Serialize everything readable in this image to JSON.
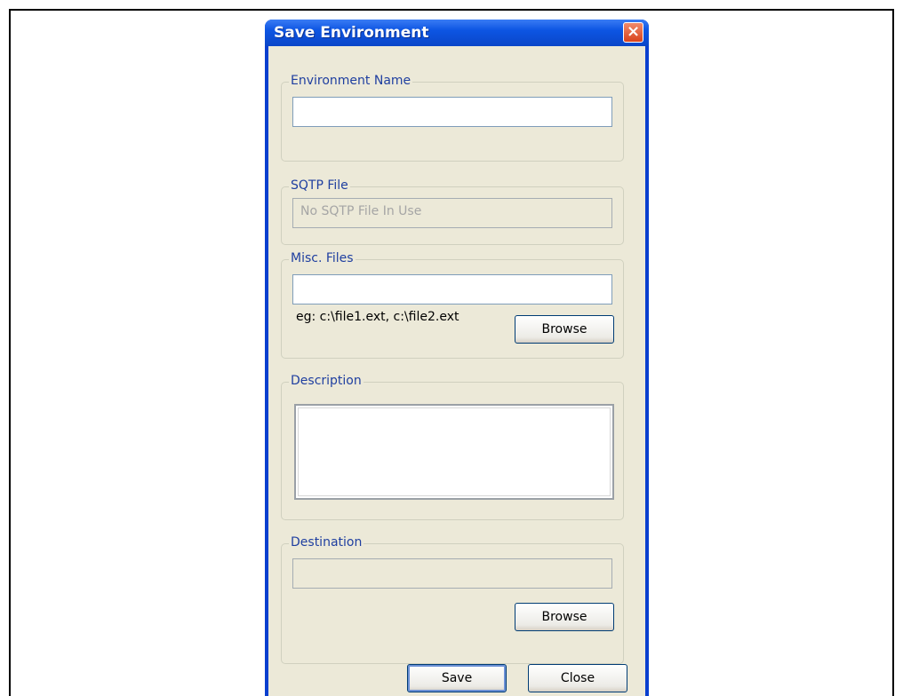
{
  "window": {
    "title": "Save Environment"
  },
  "groups": {
    "environment_name": {
      "label": "Environment Name",
      "value": ""
    },
    "sqtp_file": {
      "label": "SQTP File",
      "placeholder": "No SQTP File In Use"
    },
    "misc_files": {
      "label": "Misc. Files",
      "value": "",
      "hint": "eg: c:\\file1.ext, c:\\file2.ext",
      "browse_label": "Browse"
    },
    "description": {
      "label": "Description",
      "value": ""
    },
    "destination": {
      "label": "Destination",
      "value": "",
      "browse_label": "Browse"
    }
  },
  "buttons": {
    "save_label": "Save",
    "close_label": "Close"
  },
  "colors": {
    "titlebar": "#0d55e3",
    "client": "#ece9d8",
    "group_label": "#1f3fa0"
  },
  "icons": {
    "close": "close-icon"
  }
}
